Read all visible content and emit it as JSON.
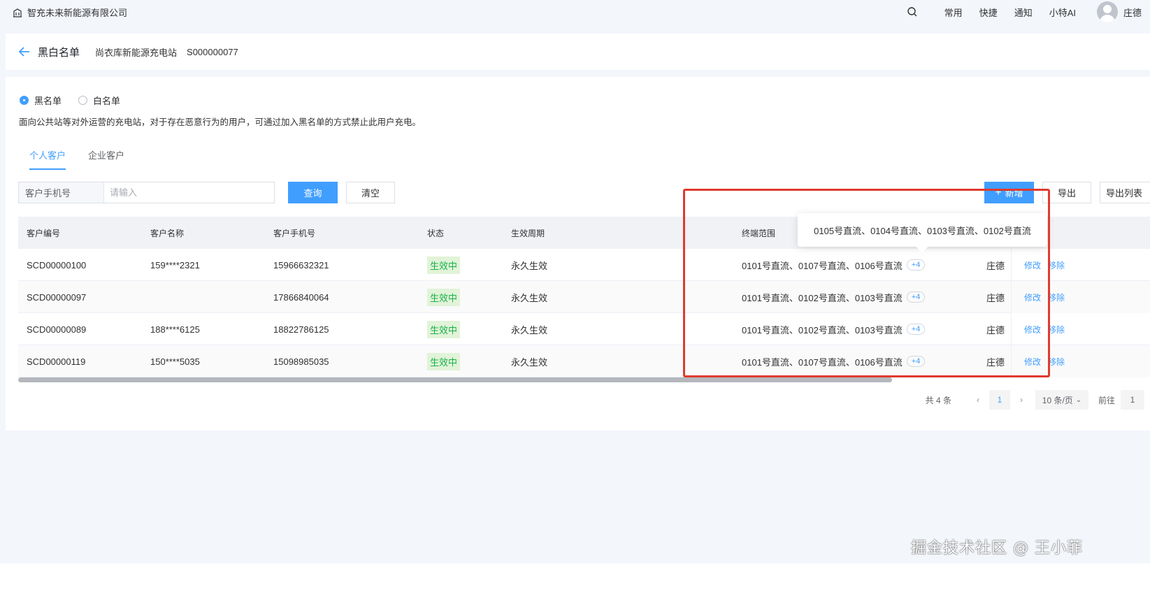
{
  "topbar": {
    "company": "智充未来新能源有限公司",
    "nav": [
      "常用",
      "快捷",
      "通知",
      "小特AI"
    ],
    "user": "庄德",
    "icons": {
      "company": "building-icon",
      "search": "search-icon",
      "avatar": "user-avatar-icon"
    }
  },
  "header": {
    "title": "黑白名单",
    "station": "尚衣库新能源充电站",
    "station_code": "S000000077"
  },
  "list_type": {
    "options": [
      "黑名单",
      "白名单"
    ],
    "selected": "黑名单"
  },
  "description": "面向公共站等对外运营的充电站，对于存在恶意行为的用户，可通过加入黑名单的方式禁止此用户充电。",
  "tabs": [
    {
      "label": "个人客户",
      "active": true
    },
    {
      "label": "企业客户",
      "active": false
    }
  ],
  "filter": {
    "label": "客户手机号",
    "placeholder": "请输入",
    "value": "",
    "query_label": "查询",
    "clear_label": "清空"
  },
  "actions": {
    "add_label": "新增",
    "export_label": "导出",
    "export_list_label": "导出列表"
  },
  "table": {
    "columns": [
      "客户编号",
      "客户名称",
      "客户手机号",
      "状态",
      "生效周期",
      "终端范围"
    ],
    "rows": [
      {
        "id": "SCD00000100",
        "name": "159****2321",
        "phone": "15966632321",
        "status": "生效中",
        "period": "永久生效",
        "range": "0101号直流、0107号直流、0106号直流",
        "more": "+4",
        "operator": "庄德",
        "edit": "修改",
        "remove": "移除"
      },
      {
        "id": "SCD00000097",
        "name": "",
        "phone": "17866840064",
        "status": "生效中",
        "period": "永久生效",
        "range": "0101号直流、0102号直流、0103号直流",
        "more": "+4",
        "operator": "庄德",
        "edit": "修改",
        "remove": "移除"
      },
      {
        "id": "SCD00000089",
        "name": "188****6125",
        "phone": "18822786125",
        "status": "生效中",
        "period": "永久生效",
        "range": "0101号直流、0102号直流、0103号直流",
        "more": "+4",
        "operator": "庄德",
        "edit": "修改",
        "remove": "移除"
      },
      {
        "id": "SCD00000119",
        "name": "150****5035",
        "phone": "15098985035",
        "status": "生效中",
        "period": "永久生效",
        "range": "0101号直流、0107号直流、0106号直流",
        "more": "+4",
        "operator": "庄德",
        "edit": "修改",
        "remove": "移除"
      }
    ]
  },
  "tooltip": "0105号直流、0104号直流、0103号直流、0102号直流",
  "pagination": {
    "total": "共 4 条",
    "current_page": "1",
    "page_size": "10 条/页",
    "goto_label": "前往",
    "goto_value": "1"
  },
  "credit": "掘金技术社区 @ 王小菲",
  "colors": {
    "primary": "#409eff",
    "status_green": "#18b24a",
    "highlight_red": "#e03a2f"
  }
}
